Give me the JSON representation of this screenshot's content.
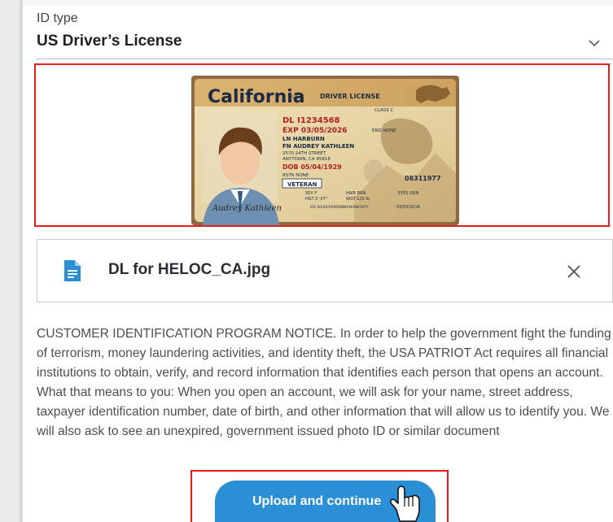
{
  "id_type": {
    "label": "ID type",
    "value": "US Driver’s License"
  },
  "license_preview": {
    "state": "California",
    "state_suffix": "USA",
    "header": "DRIVER LICENSE",
    "class": "CLASS C",
    "dl_number": "DL I1234568",
    "expires": "EXP 03/05/2026",
    "endorsements": "END NONE",
    "last_name": "LN HARBURN",
    "first_name": "FN AUDREY KATHLEEN",
    "street": "2570 24TH STREET",
    "city": "ANYTOWN, CA 95818",
    "dob": "DOB 05/04/1929",
    "restrictions": "RSTR NONE",
    "veteran": "VETERAN",
    "sex": "SEX F",
    "hair": "HAIR BRN",
    "eyes": "EYES GRN",
    "height": "HGT 5'-07\"",
    "weight": "WGT 125 lb",
    "dd": "DD 00/00/0000NNNAN/ANFD/YY",
    "issued": "03/05/2018",
    "side_number": "08311977",
    "signature": "Audrey Kathleen"
  },
  "attachment": {
    "file_name": "DL for HELOC_CA.jpg",
    "file_icon": "document-icon",
    "remove_icon": "close-icon"
  },
  "notice": {
    "text": "CUSTOMER IDENTIFICATION PROGRAM NOTICE. In order to help the government fight the funding of terrorism, money laundering activities, and identity theft, the USA PATRIOT Act requires all financial institutions to obtain, verify, and record information that identifies each person that opens an account. What that means to you: When you open an account, we will ask for your name, street address, taxpayer identification number, date of birth, and other information that will allow us to identify you. We will also ask to see an unexpired, government issued photo ID or similar document"
  },
  "actions": {
    "upload_label": "Upload and continue",
    "cursor_icon": "hand-pointer-icon"
  },
  "colors": {
    "accent": "#2b8fd6",
    "highlight_border": "#e41e1e",
    "file_icon": "#2b8fd6",
    "text_primary": "#1d1f23",
    "text_body": "#4b4f55"
  }
}
